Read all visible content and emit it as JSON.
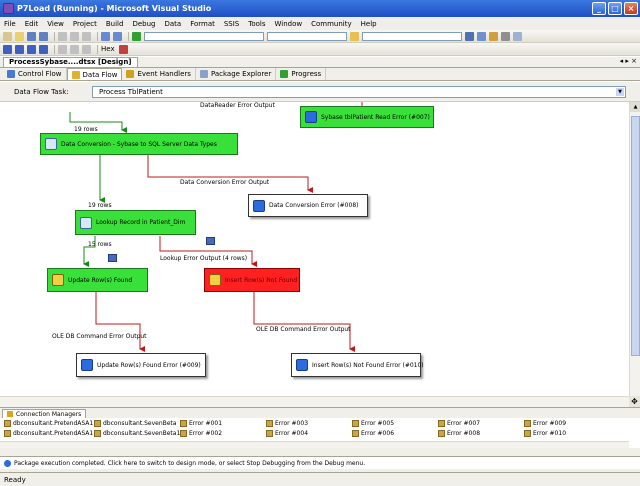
{
  "window": {
    "title": "P7Load (Running) - Microsoft Visual Studio"
  },
  "menu": [
    "File",
    "Edit",
    "View",
    "Project",
    "Build",
    "Debug",
    "Data",
    "Format",
    "SSIS",
    "Tools",
    "Window",
    "Community",
    "Help"
  ],
  "toolbar": {
    "hex_label": "Hex"
  },
  "document_tab": {
    "title": "ProcessSybase....dtsx [Design]"
  },
  "design_tabs": [
    {
      "label": "Control Flow",
      "icon": "control-flow-icon"
    },
    {
      "label": "Data Flow",
      "icon": "data-flow-icon"
    },
    {
      "label": "Event Handlers",
      "icon": "event-handlers-icon"
    },
    {
      "label": "Package Explorer",
      "icon": "package-explorer-icon"
    },
    {
      "label": "Progress",
      "icon": "progress-icon"
    }
  ],
  "data_flow_task": {
    "label": "Data Flow Task:",
    "value": "Process TblPatient"
  },
  "diagram": {
    "boxes": {
      "sybase_error": "Sybase tblPatient Read Error (#007)",
      "data_conversion": "Data Conversion - Sybase to SQL Server Data Types",
      "data_conversion_error": "Data Conversion Error (#008)",
      "lookup": "Lookup Record in Patient_Dim",
      "update": "Update Row(s) Found",
      "insert": "Insert Row(s) Not Found",
      "update_error": "Update Row(s) Found Error (#009)",
      "insert_error": "Insert Row(s) Not Found Error (#010)"
    },
    "labels": {
      "datareader_error": "DataReader Error Output",
      "rows_19_a": "19 rows",
      "conversion_error_output": "Data Conversion Error Output",
      "rows_19_b": "19 rows",
      "rows_15": "15 rows",
      "lookup_error_output": "Lookup Error Output (4 rows)",
      "oledb_error_1": "OLE DB Command Error Output",
      "oledb_error_2": "OLE DB Command Error Output"
    }
  },
  "connection_managers": {
    "tab_label": "Connection Managers",
    "row1": [
      "dbconsultant.PretendASA1",
      "dbconsultant.SevenBeta",
      "Error #001",
      "Error #003",
      "Error #005",
      "Error #007",
      "Error #009"
    ],
    "row2": [
      "dbconsultant.PretendASA1",
      "dbconsultant.SevenBeta1",
      "Error #002",
      "Error #004",
      "Error #006",
      "Error #008",
      "Error #010"
    ]
  },
  "info_bar": "Package execution completed. Click here to switch to design mode, or select Stop Debugging from the Debug menu.",
  "status": "Ready",
  "colors": {
    "success": "#39e039",
    "failure": "#ff2020",
    "title": "#1f4fc4"
  }
}
